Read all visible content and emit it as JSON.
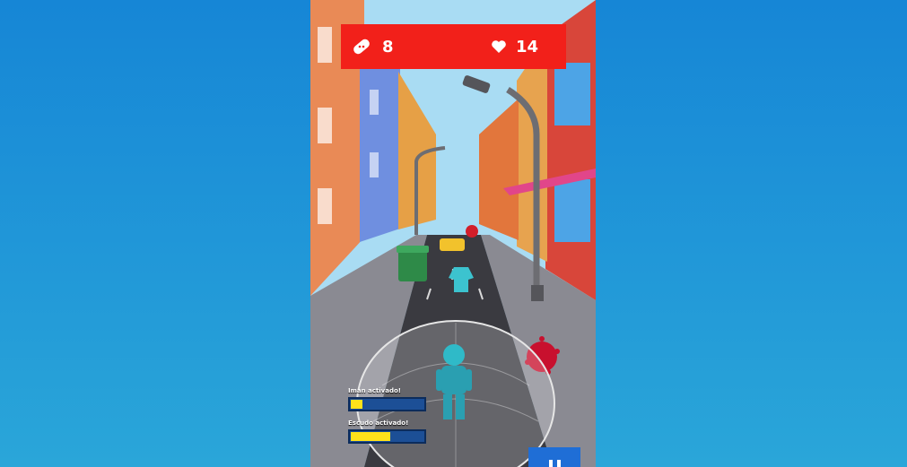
{
  "hud": {
    "bandages": {
      "icon": "bandage-icon",
      "count": "8"
    },
    "lives": {
      "icon": "heart-icon",
      "count": "14"
    },
    "color": "#f2201a"
  },
  "powerups": [
    {
      "label": "Iman activado!",
      "level": 0.18
    },
    {
      "label": "Escudo activado!",
      "level": 0.55
    }
  ],
  "controls": {
    "pause_icon": "pause-icon"
  },
  "colors": {
    "background": "#1686d6",
    "bar_fill": "#ffe21a",
    "bar_track": "#1c4f96"
  }
}
